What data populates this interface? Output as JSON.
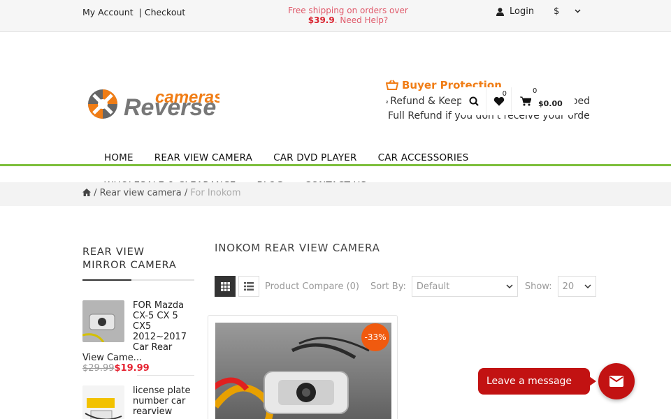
{
  "topbar": {
    "my_account": "My Account",
    "separator": "|",
    "checkout": "Checkout",
    "shipping_text": "Free shipping on orders over",
    "shipping_amount": "$39.9",
    "need_help": ". Need Help?",
    "login": "Login",
    "currency": "$",
    "currency_caret_icon": "chevron-down-icon"
  },
  "logo": {
    "line1": "cameras",
    "line2": "Reverse"
  },
  "buyer_protection": {
    "title": "Buyer Protection",
    "line1": "Refund & Keep Items, if not as described",
    "line2": "Full Refund if you don't receive your order"
  },
  "header_icons": {
    "search_icon": "search-icon",
    "wishlist_count": "0",
    "cart_count": "0",
    "cart_total": "$0.00"
  },
  "nav": {
    "row1": [
      "HOME",
      "REAR VIEW CAMERA",
      "CAR DVD PLAYER",
      "CAR ACCESSORIES"
    ],
    "row2": [
      "WHOLESALE & CLEARANCE",
      "BLOG",
      "CONTACT US"
    ]
  },
  "breadcrumb": {
    "sep": "/",
    "item1": "Rear view camera",
    "current": "For Inokom"
  },
  "sidebar": {
    "title_line1": "REAR VIEW",
    "title_line2": "MIRROR CAMERA",
    "products": [
      {
        "name": "FOR Mazda CX-5 CX 5 CX5 2012~2017 Car Rear View Came...",
        "old_price": "$29.99",
        "price": "$19.99"
      },
      {
        "name": "license plate number car rearview",
        "old_price": "",
        "price": ""
      }
    ]
  },
  "main": {
    "title": "INOKOM REAR VIEW CAMERA",
    "compare": "Product Compare (0)",
    "sort_label": "Sort By:",
    "sort_value": "Default",
    "show_label": "Show:",
    "show_value": "20",
    "sale_badge": "-33%"
  },
  "chat": {
    "label": "Leave a message"
  },
  "colors": {
    "accent_green": "#7dbf3c",
    "sale": "#f05a0f",
    "chat": "#c21212",
    "price": "#e52331"
  }
}
